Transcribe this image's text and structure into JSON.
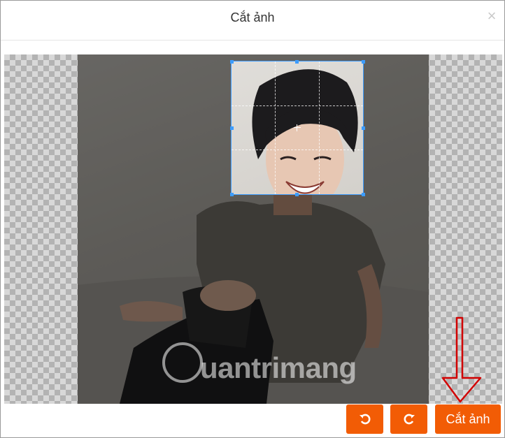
{
  "dialog": {
    "title": "Cắt ảnh",
    "close_icon": "close-icon"
  },
  "image": {
    "watermark": "uantrimang",
    "watermark_logo": "quantrimang-logo"
  },
  "toolbar": {
    "rotate_left_icon": "rotate-left-icon",
    "rotate_right_icon": "rotate-right-icon",
    "crop_label": "Cắt ảnh"
  },
  "colors": {
    "accent": "#f25c05",
    "crop_frame": "#3c9cff",
    "annotation_arrow": "#d10000"
  }
}
